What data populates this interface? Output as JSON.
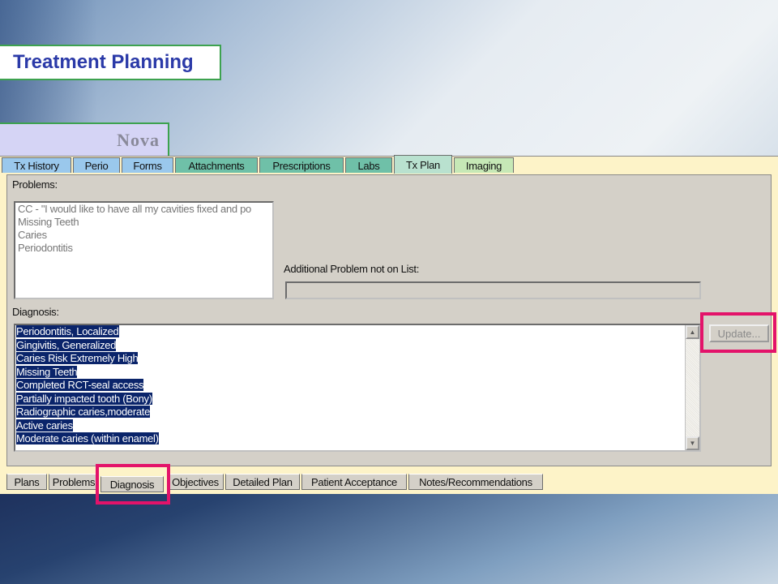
{
  "slide": {
    "title": "Treatment Planning",
    "subtitle": "Nova"
  },
  "top_tabs": [
    {
      "label": "Tx History",
      "color": "#9ac8ec"
    },
    {
      "label": "Perio",
      "color": "#9ac8ec"
    },
    {
      "label": "Forms",
      "color": "#9ac8ec"
    },
    {
      "label": "Attachments",
      "color": "#6fc0a8"
    },
    {
      "label": "Prescriptions",
      "color": "#6fc0a8"
    },
    {
      "label": "Labs",
      "color": "#6fc0a8"
    },
    {
      "label": "Tx Plan",
      "color": "#b9e1cf",
      "active": true
    },
    {
      "label": "Imaging",
      "color": "#c6e8b6"
    }
  ],
  "problems": {
    "label": "Problems:",
    "items": [
      "CC - \"I would like to have all my cavities fixed and po",
      "Missing Teeth",
      "Caries",
      "Periodontitis"
    ]
  },
  "additional_problem": {
    "label": "Additional Problem not on List:",
    "value": ""
  },
  "diagnosis": {
    "label": "Diagnosis:",
    "items": [
      "Periodontitis, Localized",
      "Gingivitis, Generalized",
      "Caries Risk Extremely High",
      "Missing Teeth",
      "Completed RCT-seal access",
      "Partially impacted tooth (Bony)",
      "Radiographic caries,moderate",
      "Active caries",
      "Moderate caries (within enamel)"
    ]
  },
  "update_button": {
    "label": "Update..."
  },
  "bottom_tabs": [
    {
      "label": "Plans"
    },
    {
      "label": "Problems"
    },
    {
      "label": "Diagnosis",
      "active": true
    },
    {
      "label": "Objectives"
    },
    {
      "label": "Detailed Plan"
    },
    {
      "label": "Patient Acceptance"
    },
    {
      "label": "Notes/Recommendations"
    }
  ],
  "colors": {
    "highlight": "#e3136a",
    "selection": "#0a246a",
    "title_text": "#2b3aa8",
    "frame_green": "#3da24f"
  }
}
